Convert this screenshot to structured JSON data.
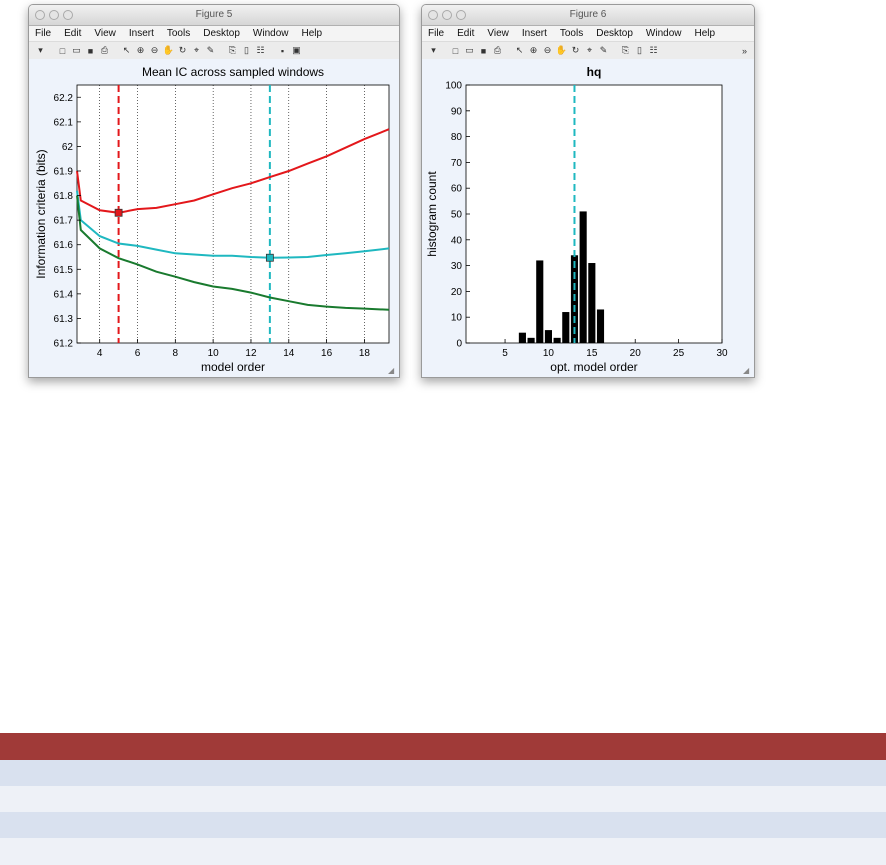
{
  "windows": [
    {
      "id": "win5",
      "title": "Figure 5",
      "menus": [
        "File",
        "Edit",
        "View",
        "Insert",
        "Tools",
        "Desktop",
        "Window",
        "Help"
      ]
    },
    {
      "id": "win6",
      "title": "Figure 6",
      "menus": [
        "File",
        "Edit",
        "View",
        "Insert",
        "Tools",
        "Desktop",
        "Window",
        "Help"
      ],
      "overflow": "»"
    }
  ],
  "toolbar_icons": [
    "arrow-icon",
    "new-file-icon",
    "open-folder-icon",
    "save-icon",
    "print-icon",
    "pointer-icon",
    "zoom-in-icon",
    "zoom-out-icon",
    "pan-icon",
    "rotate-icon",
    "datacursor-icon",
    "brush-icon",
    "link-icon",
    "colorbar-icon",
    "legend-icon",
    "hide-tools-icon",
    "show-tools-icon"
  ],
  "chart_data": [
    {
      "type": "line",
      "title": "Mean IC across sampled windows",
      "xlabel": "model order",
      "ylabel": "Information criteria (bits)",
      "xlim": [
        2.8,
        19.3
      ],
      "ylim": [
        61.2,
        62.25
      ],
      "xticks": [
        4,
        6,
        8,
        10,
        12,
        14,
        16,
        18
      ],
      "yticks": [
        61.2,
        61.3,
        61.4,
        61.5,
        61.6,
        61.7,
        61.8,
        61.9,
        62,
        62.1,
        62.2
      ],
      "ytick_labels": [
        "61.2",
        "61.3",
        "61.4",
        "61.5",
        "61.6",
        "61.7",
        "61.8",
        "61.9",
        "62",
        "62.1",
        "62.2"
      ],
      "x": [
        2.8,
        3,
        4,
        5,
        6,
        7,
        8,
        9,
        10,
        11,
        12,
        13,
        14,
        15,
        16,
        17,
        18,
        19.3
      ],
      "series": [
        {
          "color": "#e3171b",
          "values": [
            61.9,
            61.78,
            61.74,
            61.73,
            61.745,
            61.75,
            61.765,
            61.78,
            61.805,
            61.83,
            61.85,
            61.875,
            61.9,
            61.93,
            61.96,
            61.995,
            62.03,
            62.07
          ]
        },
        {
          "color": "#1fb8c0",
          "values": [
            61.82,
            61.7,
            61.635,
            61.605,
            61.595,
            61.58,
            61.565,
            61.56,
            61.555,
            61.555,
            61.55,
            61.547,
            61.548,
            61.55,
            61.558,
            61.565,
            61.573,
            61.585
          ]
        },
        {
          "color": "#197a2e",
          "values": [
            61.8,
            61.66,
            61.585,
            61.545,
            61.52,
            61.49,
            61.47,
            61.448,
            61.43,
            61.42,
            61.405,
            61.385,
            61.37,
            61.355,
            61.348,
            61.343,
            61.34,
            61.335
          ]
        }
      ],
      "markers": [
        {
          "x": 5,
          "y": 61.73,
          "color": "#e3171b"
        },
        {
          "x": 13,
          "y": 61.547,
          "color": "#1fb8c0"
        }
      ],
      "vlines_dotted": [
        4,
        6,
        8,
        10,
        12,
        14,
        16,
        18
      ],
      "vlines_dashed": [
        {
          "x": 5,
          "color": "#e3171b"
        },
        {
          "x": 13,
          "color": "#1fb8c0"
        }
      ]
    },
    {
      "type": "bar",
      "title": "hq",
      "xlabel": "opt. model order",
      "ylabel": "histogram count",
      "xlim": [
        0.5,
        30
      ],
      "ylim": [
        0,
        100
      ],
      "xticks": [
        5,
        10,
        15,
        20,
        25,
        30
      ],
      "yticks": [
        0,
        10,
        20,
        30,
        40,
        50,
        60,
        70,
        80,
        90,
        100
      ],
      "x": [
        7,
        8,
        9,
        10,
        11,
        12,
        13,
        14,
        15,
        16
      ],
      "values": [
        4,
        2,
        32,
        5,
        2,
        12,
        34,
        51,
        31,
        13
      ],
      "bar_color": "#000000",
      "vline_dashed": {
        "x": 13,
        "color": "#1fb8c0"
      }
    }
  ]
}
